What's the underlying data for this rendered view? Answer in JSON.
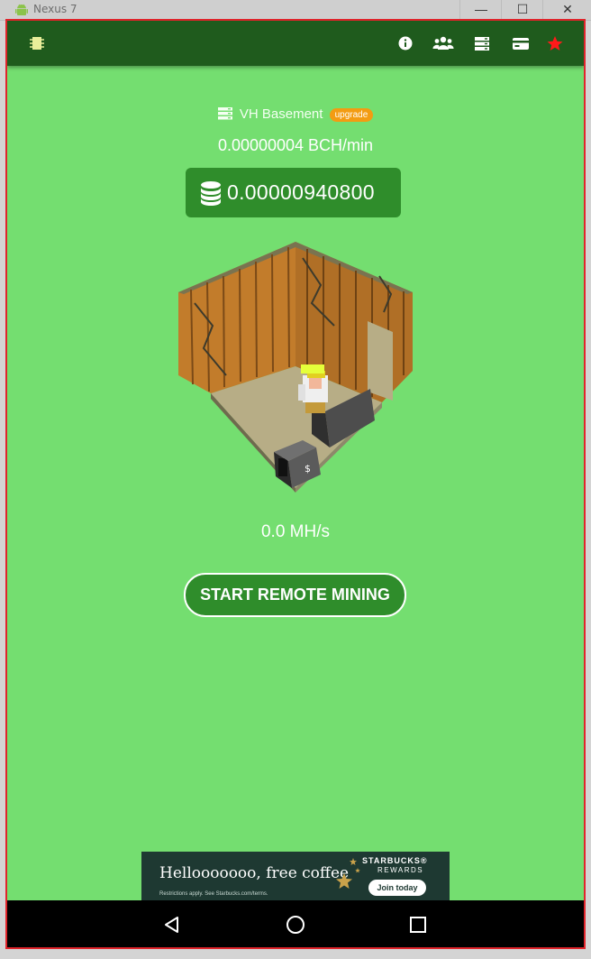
{
  "window": {
    "title": "Nexus 7",
    "minimize_glyph": "—",
    "maximize_glyph": "☐",
    "close_glyph": "✕"
  },
  "app_bar": {
    "icons": [
      "chip-icon",
      "info-icon",
      "users-icon",
      "server-icon",
      "card-icon",
      "star-icon"
    ]
  },
  "server": {
    "name": "VH Basement",
    "badge": "upgrade"
  },
  "mining": {
    "rate": "0.00000004 BCH/min",
    "balance": "0.00000940800",
    "hashrate": "0.0 MH/s",
    "button": "START REMOTE MINING"
  },
  "ad": {
    "headline": "Hellooooooo, free coffee",
    "fine_print": "Restrictions apply. See Starbucks.com/terms.",
    "brand": "STARBUCKS®",
    "program": "REWARDS",
    "cta": "Join today"
  },
  "colors": {
    "background": "#74de70",
    "app_bar": "#1f5b1d",
    "accent": "#2f8d2b",
    "badge": "#f39c12",
    "frame_outline": "#e0242b"
  }
}
